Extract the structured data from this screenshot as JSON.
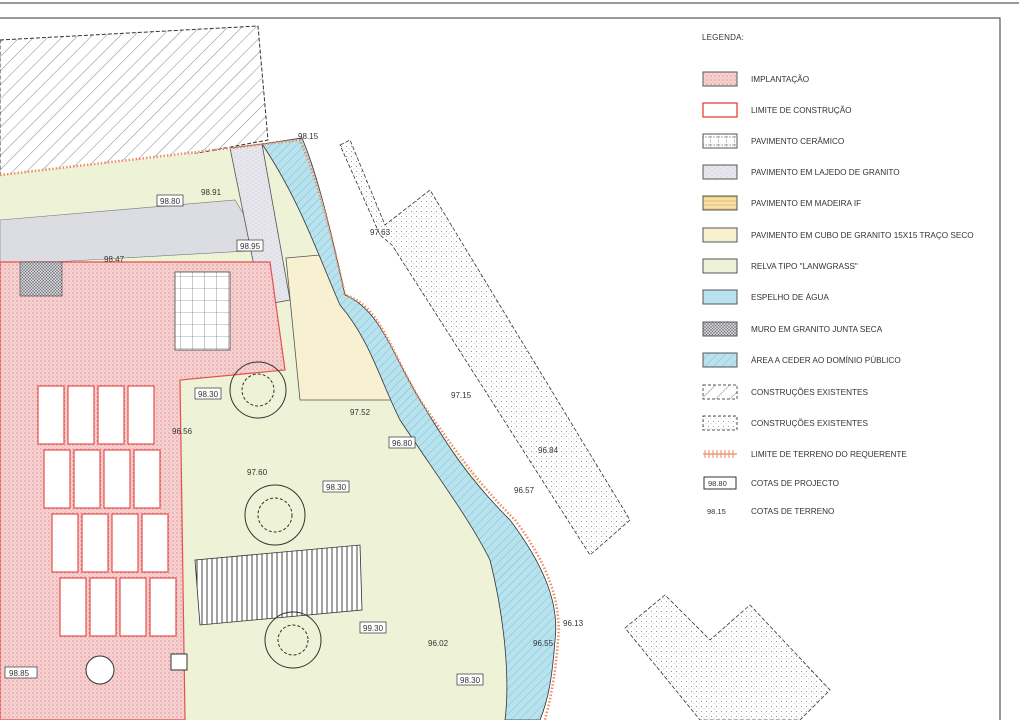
{
  "legend": {
    "title": "LEGENDA:",
    "items": [
      {
        "label": "IMPLANTAÇÃO",
        "swatch": "implantacao"
      },
      {
        "label": "LIMITE DE CONSTRUÇÃO",
        "swatch": "limite"
      },
      {
        "label": "PAVIMENTO CERÂMICO",
        "swatch": "ceramico"
      },
      {
        "label": "PAVIMENTO EM LAJEDO DE GRANITO",
        "swatch": "lajedo"
      },
      {
        "label": "PAVIMENTO EM MADEIRA IF",
        "swatch": "madeira"
      },
      {
        "label": "PAVIMENTO EM CUBO DE GRANITO 15X15 TRAÇO SECO",
        "swatch": "cubo"
      },
      {
        "label": "RELVA TIPO \"LANWGRASS\"",
        "swatch": "relva"
      },
      {
        "label": "ESPELHO DE ÁGUA",
        "swatch": "agua"
      },
      {
        "label": "MURO EM GRANITO JUNTA SECA",
        "swatch": "muro"
      },
      {
        "label": "ÁREA A CEDER AO DOMÍNIO PÚBLICO",
        "swatch": "ceder"
      },
      {
        "label": "CONSTRUÇÕES EXISTENTES",
        "swatch": "existentes_hatch"
      },
      {
        "label": "CONSTRUÇÕES EXISTENTES",
        "swatch": "existentes_dots"
      },
      {
        "label": "LIMITE DE TERRENO DO REQUERENTE",
        "swatch": "terreno"
      },
      {
        "label": "COTAS DE PROJECTO",
        "swatch": "cota_proj",
        "sample": "98.80"
      },
      {
        "label": "COTAS DE TERRENO",
        "swatch": "cota_terr",
        "sample": "98.15"
      }
    ]
  },
  "plan": {
    "cotas_terreno": [
      "98.15",
      "98.91",
      "98.47",
      "97.15",
      "96.57",
      "96.13",
      "96.55",
      "96.02",
      "97.52",
      "97.60",
      "96.56",
      "97.63",
      "96.84"
    ],
    "cotas_projecto": [
      "98.80",
      "98.95",
      "98.30",
      "96.80",
      "98.30",
      "99.30",
      "98.30",
      "98.85"
    ]
  },
  "colors": {
    "implantacao": "#f6d2d2",
    "limite": "#e8514b",
    "relva": "#eef2d6",
    "cubo": "#f7f1d2",
    "agua": "#b8e2ee",
    "terreno": "#f08a60",
    "line": "#444444"
  }
}
